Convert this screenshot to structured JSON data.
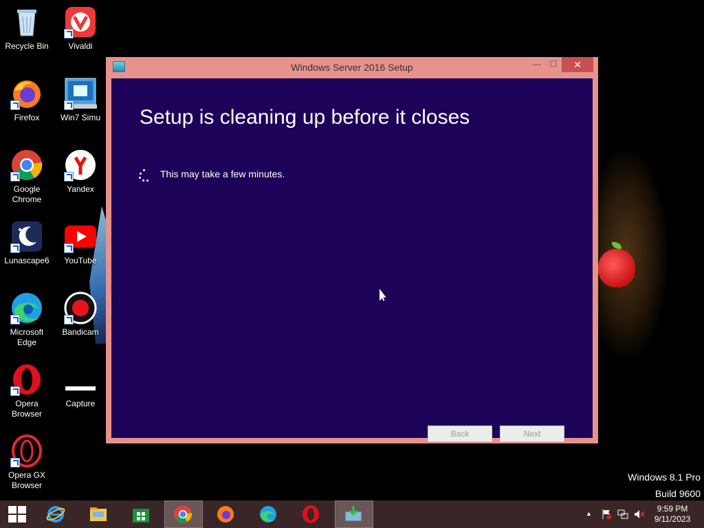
{
  "desktop": {
    "icons": [
      {
        "label": "Recycle Bin"
      },
      {
        "label": "Vivaldi"
      },
      {
        "label": "Firefox"
      },
      {
        "label": "Win7 Simu"
      },
      {
        "label": "Google Chrome"
      },
      {
        "label": "Yandex"
      },
      {
        "label": "Lunascape6"
      },
      {
        "label": "YouTube"
      },
      {
        "label": "Microsoft Edge"
      },
      {
        "label": "Bandicam"
      },
      {
        "label": "Opera Browser"
      },
      {
        "label": "Capture"
      },
      {
        "label": "Opera GX Browser"
      }
    ]
  },
  "window": {
    "title": "Windows Server 2016 Setup",
    "heading": "Setup is cleaning up before it closes",
    "message": "This may take a few minutes.",
    "back_label": "Back",
    "next_label": "Next",
    "close_glyph": "✕",
    "minimize_glyph": "—",
    "maximize_glyph": "☐"
  },
  "watermark": {
    "line1": "Windows 8.1 Pro",
    "line2": "Build 9600"
  },
  "taskbar": {
    "apps": [
      "internet-explorer",
      "file-explorer",
      "store",
      "chrome",
      "firefox",
      "edge",
      "opera",
      "setup"
    ],
    "active": [
      "chrome",
      "setup"
    ],
    "tray_up_glyph": "▲",
    "time": "9:59 PM",
    "date": "9/11/2023"
  },
  "colors": {
    "window_frame": "#e8928c",
    "setup_background": "#1c0259",
    "close_button": "#c75050",
    "taskbar": "#3a2626"
  }
}
